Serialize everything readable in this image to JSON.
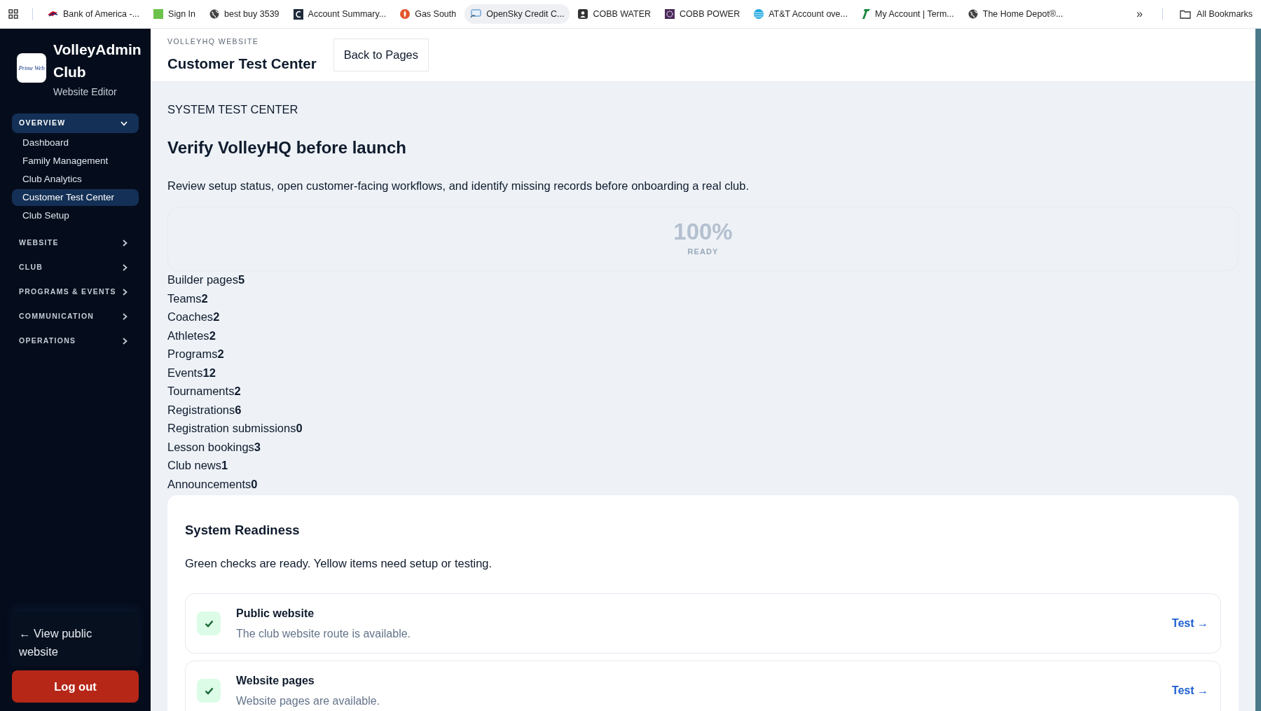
{
  "bookmarks": [
    {
      "label": "Bank of America -...",
      "selected": false
    },
    {
      "label": "Sign In",
      "selected": false
    },
    {
      "label": "best buy 3539",
      "selected": false
    },
    {
      "label": "Account Summary...",
      "selected": false
    },
    {
      "label": "Gas South",
      "selected": false
    },
    {
      "label": "OpenSky Credit C...",
      "selected": true
    },
    {
      "label": "COBB WATER",
      "selected": false
    },
    {
      "label": "COBB POWER",
      "selected": false
    },
    {
      "label": "AT&T Account ove...",
      "selected": false
    },
    {
      "label": "My Account | Term...",
      "selected": false
    },
    {
      "label": "The Home Depot®...",
      "selected": false
    }
  ],
  "bookmarks_overflow": "»",
  "all_bookmarks": "All Bookmarks",
  "sidebar": {
    "logo_text": "Prime Web",
    "title": "VolleyAdmin Club",
    "subtitle": "Website Editor",
    "groups": [
      {
        "label": "OVERVIEW",
        "expanded": true,
        "items": [
          {
            "label": "Dashboard",
            "selected": false
          },
          {
            "label": "Family Management",
            "selected": false
          },
          {
            "label": "Club Analytics",
            "selected": false
          },
          {
            "label": "Customer Test Center",
            "selected": true
          },
          {
            "label": "Club Setup",
            "selected": false
          }
        ]
      },
      {
        "label": "WEBSITE",
        "expanded": false
      },
      {
        "label": "CLUB",
        "expanded": false
      },
      {
        "label": "PROGRAMS & EVENTS",
        "expanded": false
      },
      {
        "label": "COMMUNICATION",
        "expanded": false
      },
      {
        "label": "OPERATIONS",
        "expanded": false
      }
    ],
    "view_public": "← View public website",
    "logout": "Log out"
  },
  "header": {
    "eyebrow": "VOLLEYHQ WEBSITE",
    "title": "Customer Test Center",
    "back_button": "Back to Pages"
  },
  "main": {
    "section_label": "SYSTEM TEST CENTER",
    "title": "Verify VolleyHQ before launch",
    "description": "Review setup status, open customer-facing workflows, and identify missing records before onboarding a real club.",
    "score": "100%",
    "score_label": "READY",
    "stats": [
      {
        "label": "Builder pages",
        "value": "5"
      },
      {
        "label": "Teams",
        "value": "2"
      },
      {
        "label": "Coaches",
        "value": "2"
      },
      {
        "label": "Athletes",
        "value": "2"
      },
      {
        "label": "Programs",
        "value": "2"
      },
      {
        "label": "Events",
        "value": "12"
      },
      {
        "label": "Tournaments",
        "value": "2"
      },
      {
        "label": "Registrations",
        "value": "6"
      },
      {
        "label": "Registration submissions",
        "value": "0"
      },
      {
        "label": "Lesson bookings",
        "value": "3"
      },
      {
        "label": "Club news",
        "value": "1"
      },
      {
        "label": "Announcements",
        "value": "0"
      }
    ],
    "readiness": {
      "title": "System Readiness",
      "description": "Green checks are ready. Yellow items need setup or testing.",
      "items": [
        {
          "title": "Public website",
          "description": "The club website route is available.",
          "ready": true,
          "action": "Test →"
        },
        {
          "title": "Website pages",
          "description": "Website pages are available.",
          "ready": true,
          "action": "Test →"
        }
      ]
    }
  }
}
